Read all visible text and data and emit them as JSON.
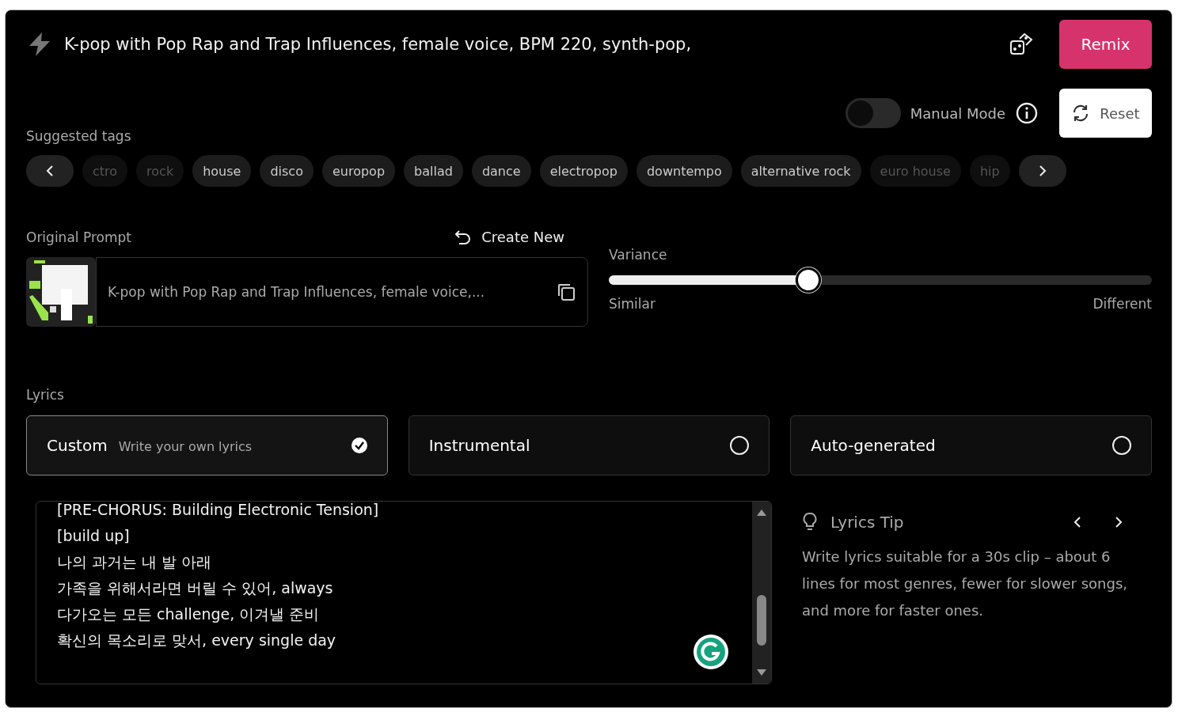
{
  "prompt_bar": {
    "text": "K-pop with Pop Rap and Trap Influences, female voice, BPM 220,  synth-pop,",
    "remix_button": "Remix"
  },
  "controls": {
    "manual_mode": {
      "label": "Manual Mode",
      "on": false
    },
    "reset_button": "Reset"
  },
  "suggested_tags": {
    "title": "Suggested tags",
    "tags": [
      {
        "label": "ctro",
        "faded": true
      },
      {
        "label": "rock",
        "faded": true
      },
      {
        "label": "house",
        "faded": false
      },
      {
        "label": "disco",
        "faded": false
      },
      {
        "label": "europop",
        "faded": false
      },
      {
        "label": "ballad",
        "faded": false
      },
      {
        "label": "dance",
        "faded": false
      },
      {
        "label": "electropop",
        "faded": false
      },
      {
        "label": "downtempo",
        "faded": false
      },
      {
        "label": "alternative rock",
        "faded": false
      },
      {
        "label": "euro house",
        "faded": true
      },
      {
        "label": "hip",
        "faded": true
      }
    ]
  },
  "original_prompt": {
    "title": "Original Prompt",
    "create_new": "Create New",
    "text": "K-pop with Pop Rap and Trap Influences, female voice,..."
  },
  "variance": {
    "title": "Variance",
    "level": 0.366,
    "min_label": "Similar",
    "max_label": "Different"
  },
  "lyrics": {
    "title": "Lyrics",
    "options": [
      {
        "label": "Custom",
        "hint": "Write your own lyrics",
        "selected": true
      },
      {
        "label": "Instrumental",
        "selected": false
      },
      {
        "label": "Auto-generated",
        "selected": false
      }
    ],
    "lines": [
      "[PRE-CHORUS: Building Electronic Tension]",
      "[build up]",
      "나의 과거는 내 발 아래",
      "가족을 위해서라면 버릴 수 있어, always",
      "다가오는 모든 challenge, 이겨낼 준비",
      "확신의 목소리로 맞서, every single day"
    ]
  },
  "lyrics_tip": {
    "title": "Lyrics Tip",
    "text": "Write lyrics suitable for a 30s clip – about 6 lines for most genres, fewer for slower songs, and more for faster ones."
  }
}
